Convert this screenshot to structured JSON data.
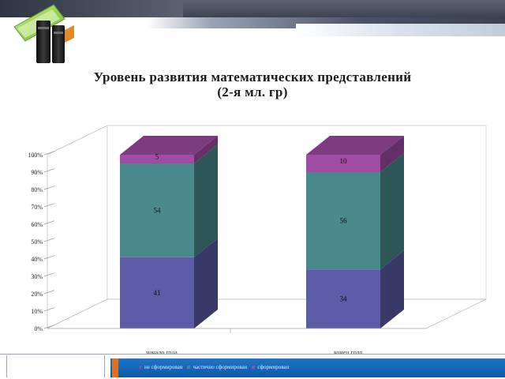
{
  "slide": {
    "title_line1": "Уровень развития математических представлений",
    "title_line2": "(2-я мл. гр)",
    "colors": {
      "top_bar": "#474c5b",
      "footer_bar": "#1565b8",
      "footer_accent": "#e07020"
    },
    "logo_icon": "books-icon"
  },
  "chart_data": {
    "type": "bar",
    "stacked": true,
    "three_d": true,
    "categories": [
      "начало года",
      "конец года"
    ],
    "series": [
      {
        "name": "не сформирован",
        "values": [
          41,
          34
        ],
        "value_labels": [
          "41",
          "34"
        ],
        "color": "#5c5ca6"
      },
      {
        "name": "частично сформирован",
        "values": [
          54,
          56
        ],
        "value_labels": [
          "54",
          "56"
        ],
        "color": "#4a8a8c"
      },
      {
        "name": "сформирован",
        "values": [
          5,
          10
        ],
        "value_labels": [
          "5",
          "10"
        ],
        "color": "#a04ca4"
      }
    ],
    "ylim": [
      0,
      100
    ],
    "yticks": [
      "0%",
      "10%",
      "20%",
      "30%",
      "40%",
      "50%",
      "60%",
      "70%",
      "80%",
      "90%",
      "100%"
    ],
    "grid": false,
    "legend_position": "bottom"
  }
}
